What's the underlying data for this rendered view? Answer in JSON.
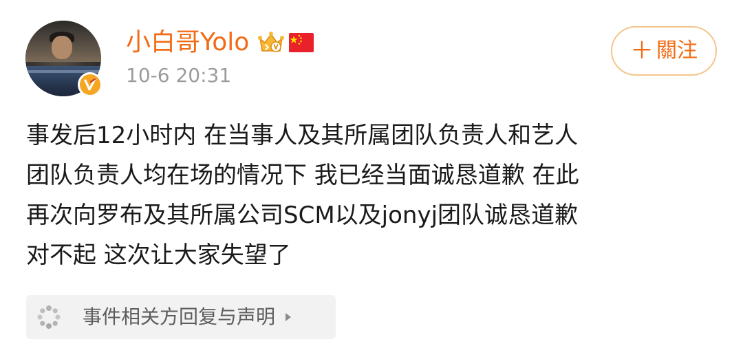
{
  "post": {
    "username": "小白哥Yolo",
    "timestamp": "10-6 20:31",
    "follow_button": {
      "plus": "＋",
      "label": "關注"
    },
    "content_lines": [
      "事发后12小时内 在当事人及其所属团队负责人和艺人",
      "团队负责人均在场的情况下 我已经当面诚恳道歉  在此",
      "再次向罗布及其所属公司SCM以及jonyj团队诚恳道歉",
      "对不起 这次让大家失望了"
    ],
    "topic_card": {
      "label": "事件相关方回复与声明"
    }
  },
  "icons": {
    "avatar": "user-avatar-photo",
    "verified": "verified-v-badge-icon",
    "vip": "vip-crown-icon",
    "flag": "china-flag-icon",
    "topic": "loading-dots-icon",
    "arrow": "triangle-right-icon"
  },
  "colors": {
    "username": "#f26b14",
    "follow_border": "#f5c48a",
    "timestamp": "#9b9b9b",
    "text": "#1a1a1a",
    "verified_badge": "#f5a623",
    "topic_bg": "#f2f2f2"
  }
}
